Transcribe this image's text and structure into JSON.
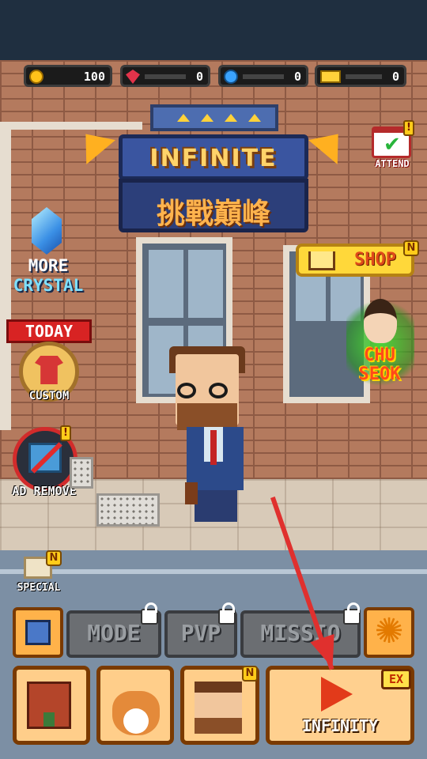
{
  "currency": {
    "gold": {
      "icon": "gold-coin-icon",
      "value": "100"
    },
    "ruby": {
      "icon": "ruby-gem-icon",
      "value": "0"
    },
    "crystal": {
      "icon": "blue-crystal-icon",
      "value": "0"
    },
    "ticket": {
      "icon": "ticket-icon",
      "value": "0"
    }
  },
  "title": {
    "main": "INFINITE",
    "sub": "挑戰巔峰"
  },
  "left_menu": {
    "crystal": {
      "line1": "MORE",
      "line2": "CRYSTAL"
    },
    "today": "TODAY",
    "custom": "CUSTOM",
    "ad_remove": "AD REMOVE",
    "alert_mark": "!"
  },
  "right_menu": {
    "attend": "ATTEND",
    "attend_check": "✔",
    "shop": "SHOP",
    "new_badge": "N",
    "chu_seok": {
      "line1": "CHU",
      "line2": "SEOK"
    }
  },
  "special": {
    "label": "SPECIAL",
    "new_badge": "N"
  },
  "mode_row": {
    "mode": "MODE",
    "pvp": "PVP",
    "mission": "MISSIO",
    "settings_glyph": "✺"
  },
  "bottom_row": {
    "infinity": "INFINITY",
    "ex_badge": "EX",
    "new_badge": "N"
  },
  "colors": {
    "arrow": "#e0302e",
    "accent": "#ffd08f",
    "locked": "#6b6e72"
  }
}
